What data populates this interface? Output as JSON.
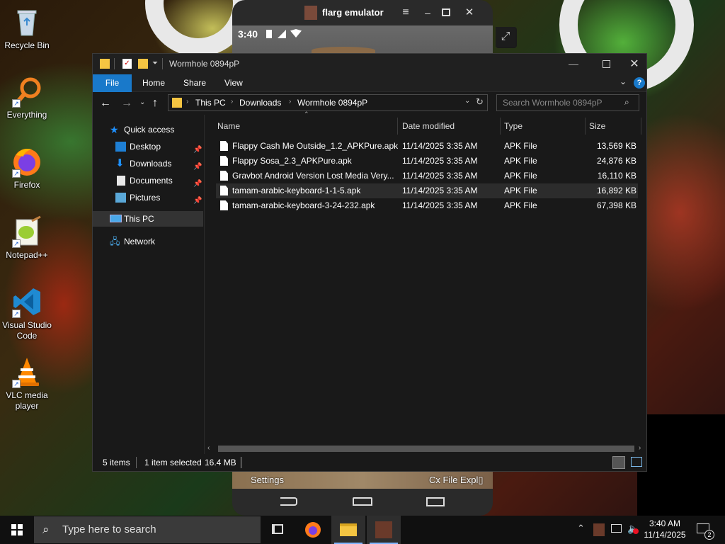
{
  "desktop": {
    "icons": [
      {
        "label": "Recycle Bin",
        "icon": "recycle-bin-icon"
      },
      {
        "label": "Everything",
        "icon": "everything-search-icon"
      },
      {
        "label": "Firefox",
        "icon": "firefox-icon"
      },
      {
        "label": "Notepad++",
        "icon": "notepad-plus-plus-icon"
      },
      {
        "label": "Visual Studio Code",
        "label_line1": "Visual Studio",
        "label_line2": "Code",
        "icon": "vscode-icon"
      },
      {
        "label": "VLC media player",
        "label_line1": "VLC media",
        "label_line2": "player",
        "icon": "vlc-icon"
      }
    ]
  },
  "emulator": {
    "title": "flarg emulator",
    "status_time": "3:40",
    "bottom_left": "Settings",
    "bottom_right": "Cx File Expl▯"
  },
  "explorer": {
    "window_title": "Wormhole 0894pP",
    "ribbon_tabs": [
      "File",
      "Home",
      "Share",
      "View"
    ],
    "breadcrumb": [
      "This PC",
      "Downloads",
      "Wormhole 0894pP"
    ],
    "search_placeholder": "Search Wormhole 0894pP",
    "nav": {
      "quick_access": "Quick access",
      "pinned": [
        "Desktop",
        "Downloads",
        "Documents",
        "Pictures"
      ],
      "this_pc": "This PC",
      "network": "Network"
    },
    "columns": [
      "Name",
      "Date modified",
      "Type",
      "Size"
    ],
    "files": [
      {
        "name": "Flappy Cash Me Outside_1.2_APKPure.apk",
        "date": "11/14/2025 3:35 AM",
        "type": "APK File",
        "size": "13,569 KB",
        "selected": false
      },
      {
        "name": "Flappy Sosa_2.3_APKPure.apk",
        "date": "11/14/2025 3:35 AM",
        "type": "APK File",
        "size": "24,876 KB",
        "selected": false
      },
      {
        "name": "Gravbot Android Version Lost Media Very...",
        "date": "11/14/2025 3:35 AM",
        "type": "APK File",
        "size": "16,110 KB",
        "selected": false
      },
      {
        "name": "tamam-arabic-keyboard-1-1-5.apk",
        "date": "11/14/2025 3:35 AM",
        "type": "APK File",
        "size": "16,892 KB",
        "selected": true
      },
      {
        "name": "tamam-arabic-keyboard-3-24-232.apk",
        "date": "11/14/2025 3:35 AM",
        "type": "APK File",
        "size": "67,398 KB",
        "selected": false
      }
    ],
    "status": {
      "items": "5 items",
      "selection": "1 item selected",
      "selection_size": "16.4 MB"
    }
  },
  "taskbar": {
    "search_placeholder": "Type here to search",
    "clock_time": "3:40 AM",
    "clock_date": "11/14/2025",
    "notification_count": "2"
  },
  "colors": {
    "accent": "#0078d7",
    "explorer_bg": "#191919",
    "titlebar_bg": "#202020",
    "selected_row": "#2c2c2c",
    "folder_yellow": "#f5c542"
  }
}
